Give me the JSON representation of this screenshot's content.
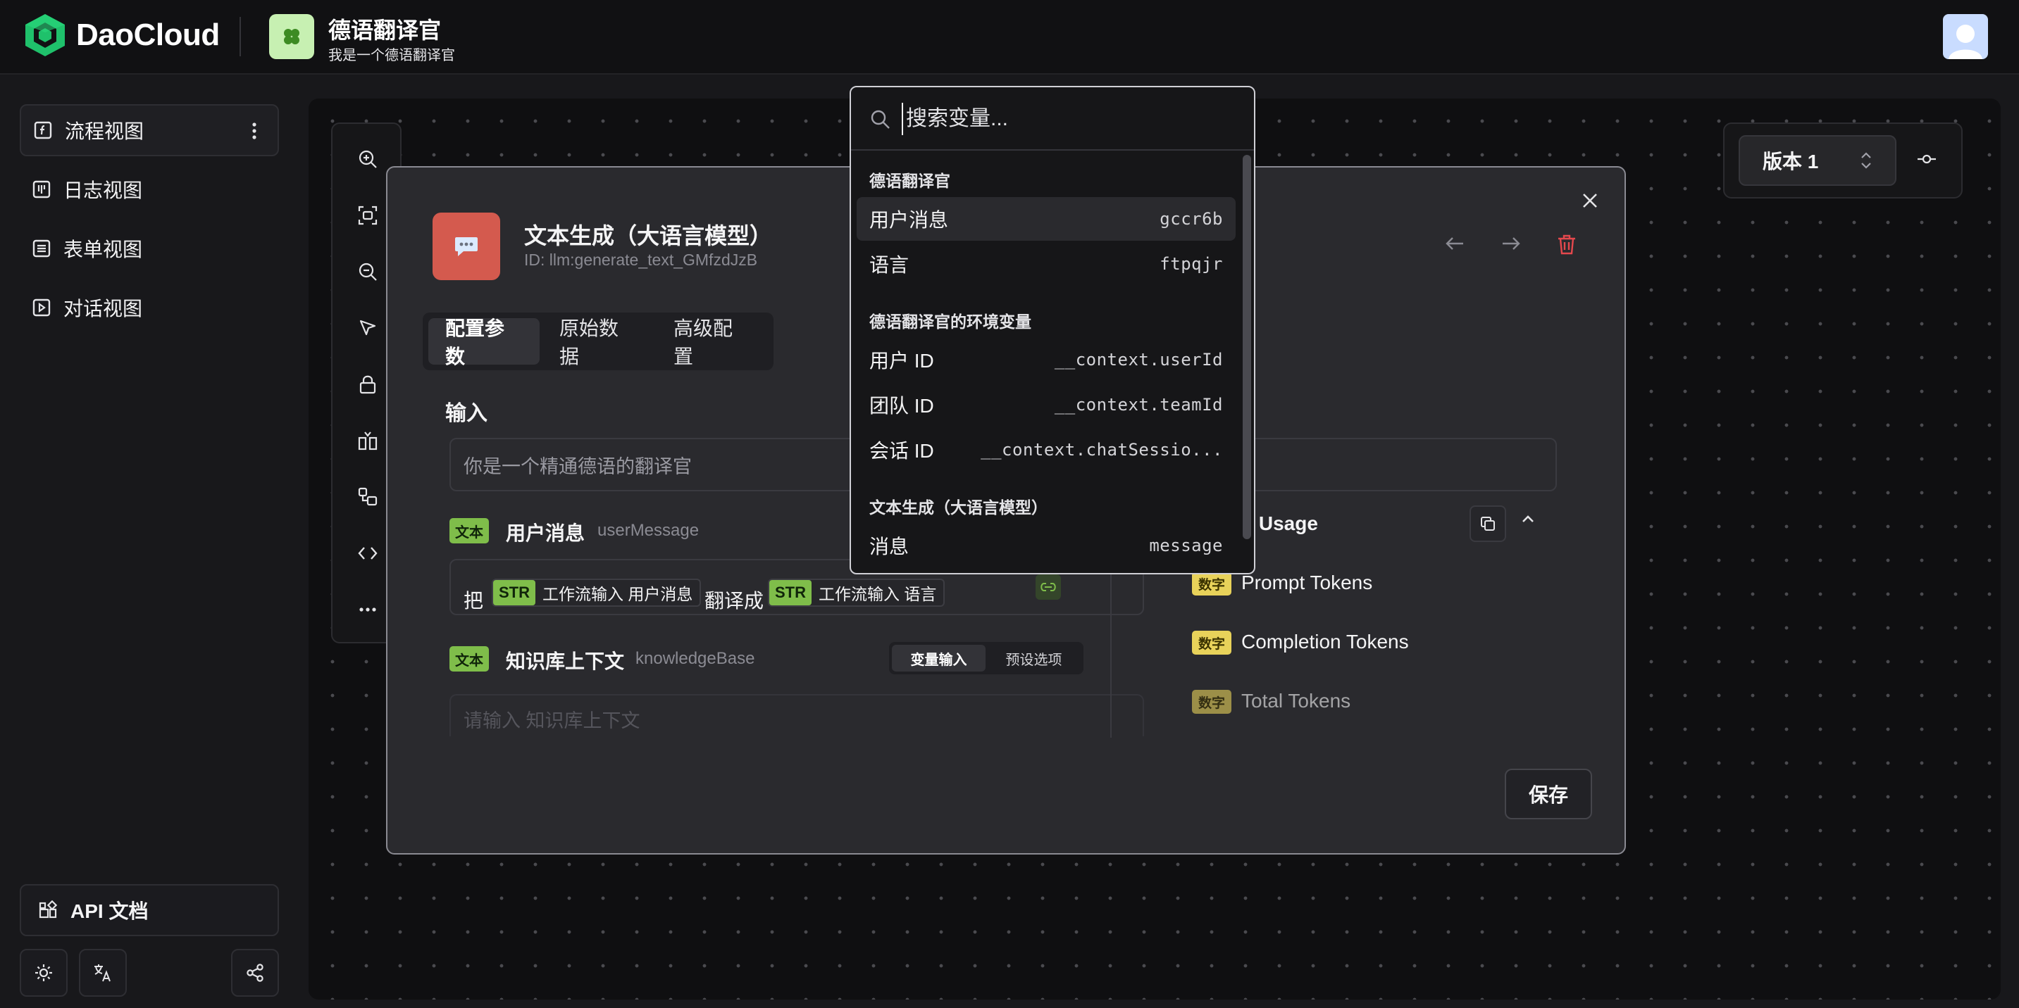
{
  "header": {
    "brand": "DaoCloud",
    "app_title": "德语翻译官",
    "app_subtitle": "我是一个德语翻译官",
    "app_icon": "clover-icon"
  },
  "sidebar": {
    "items": [
      {
        "label": "流程视图",
        "icon": "function-icon",
        "active": true
      },
      {
        "label": "日志视图",
        "icon": "log-icon"
      },
      {
        "label": "表单视图",
        "icon": "form-icon"
      },
      {
        "label": "对话视图",
        "icon": "chat-icon"
      }
    ],
    "api_doc_label": "API 文档"
  },
  "canvas": {
    "version_label": "版本 1"
  },
  "node_modal": {
    "icon": "chat-bubble-icon",
    "title": "文本生成（大语言模型）",
    "id_text": "ID: llm:generate_text_GMfzdJzB",
    "tabs": [
      "配置参数",
      "原始数据",
      "高级配置"
    ],
    "active_tab": 0,
    "input_heading": "输入",
    "system_value": "你是一个精通德语的翻译官",
    "fields": {
      "user_message": {
        "badge": "文本",
        "label": "用户消息",
        "key": "userMessage",
        "prefix": "把",
        "middle": "翻译成",
        "chip1_type": "STR",
        "chip1_text": "工作流输入 用户消息",
        "chip2_type": "STR",
        "chip2_text": "工作流输入 语言"
      },
      "knowledge_base": {
        "badge": "文本",
        "label": "知识库上下文",
        "key": "knowledgeBase",
        "seg_options": [
          "变量输入",
          "预设选项"
        ],
        "active_seg": 0,
        "placeholder": "请输入 知识库上下文"
      }
    },
    "output": {
      "usage_label": "n Usage",
      "tokens": [
        {
          "badge": "数字",
          "label": "Prompt Tokens"
        },
        {
          "badge": "数字",
          "label": "Completion Tokens"
        },
        {
          "badge": "数字",
          "label": "Total Tokens"
        }
      ]
    },
    "save_label": "保存"
  },
  "variable_picker": {
    "search_placeholder": "搜索变量...",
    "groups": [
      {
        "title": "德语翻译官",
        "options": [
          {
            "name": "用户消息",
            "key": "gccr6b",
            "highlighted": true
          },
          {
            "name": "语言",
            "key": "ftpqjr"
          }
        ]
      },
      {
        "title": "德语翻译官的环境变量",
        "options": [
          {
            "name": "用户 ID",
            "key": "__context.userId"
          },
          {
            "name": "团队 ID",
            "key": "__context.teamId"
          },
          {
            "name": "会话 ID",
            "key": "__context.chatSessio..."
          }
        ]
      },
      {
        "title": "文本生成（大语言模型）",
        "options": [
          {
            "name": "消息",
            "key": "message"
          }
        ]
      }
    ]
  },
  "colors": {
    "accent_green": "#7fbd4a",
    "number_yellow": "#e8d25a",
    "node_red": "#d45a4e",
    "danger": "#e5484d",
    "brand_green": "#1fc16b"
  }
}
